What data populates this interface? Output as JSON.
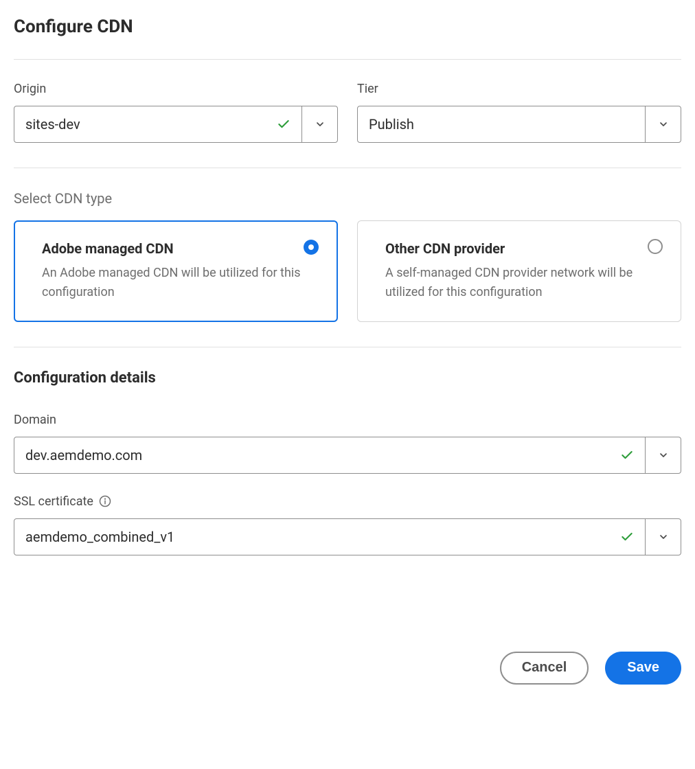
{
  "page": {
    "title": "Configure CDN"
  },
  "origin": {
    "label": "Origin",
    "value": "sites-dev"
  },
  "tier": {
    "label": "Tier",
    "value": "Publish"
  },
  "cdn_type": {
    "label": "Select CDN type",
    "options": [
      {
        "title": "Adobe managed CDN",
        "desc": "An Adobe managed CDN will be utilized for this configuration"
      },
      {
        "title": "Other CDN provider",
        "desc": "A self-managed CDN provider network will be utilized for this configuration"
      }
    ]
  },
  "config_details": {
    "heading": "Configuration details"
  },
  "domain": {
    "label": "Domain",
    "value": "dev.aemdemo.com"
  },
  "ssl": {
    "label": "SSL certificate",
    "value": "aemdemo_combined_v1"
  },
  "actions": {
    "cancel": "Cancel",
    "save": "Save"
  }
}
